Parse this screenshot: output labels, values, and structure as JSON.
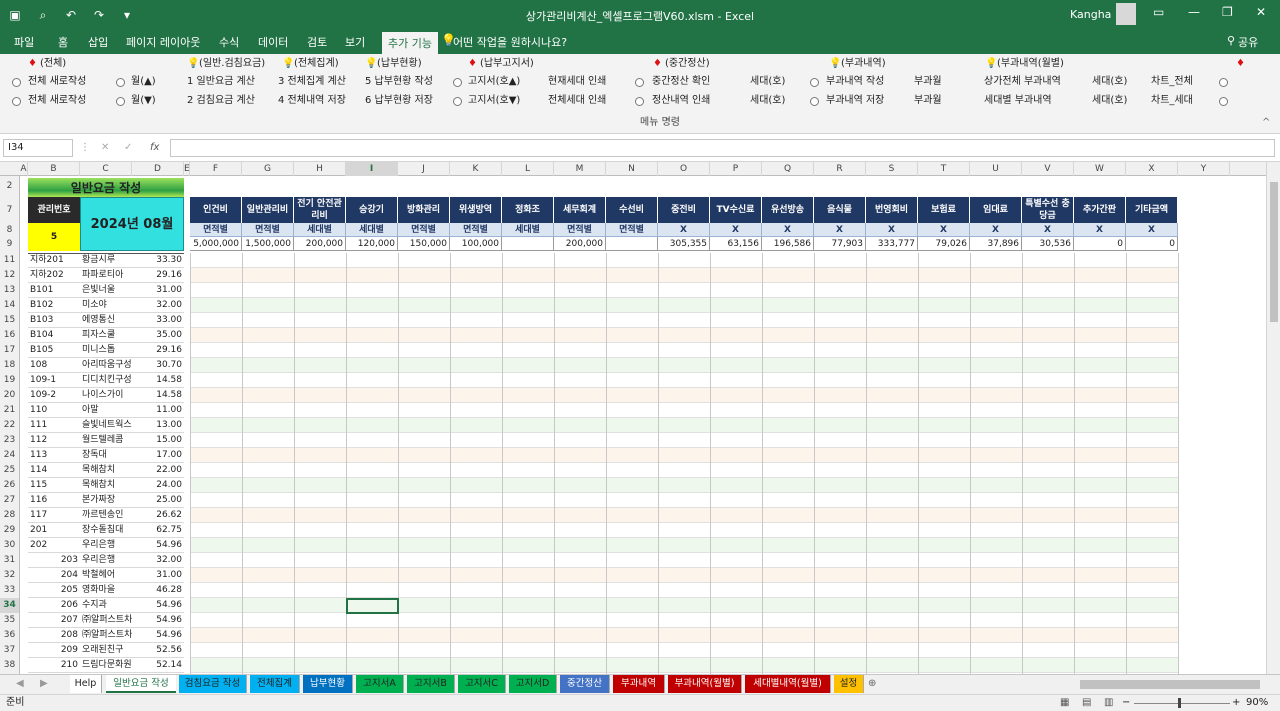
{
  "window": {
    "title": "상가관리비계산_엑셀프로그램V60.xlsm  -  Excel",
    "user": "Kangha"
  },
  "tabs": [
    "파일",
    "홈",
    "삽입",
    "페이지 레이아웃",
    "수식",
    "데이터",
    "검토",
    "보기",
    "추가 기능",
    "어떤 작업을 원하시나요?",
    "공유"
  ],
  "ribbon": {
    "group_label": "메뉴 명령",
    "headers": [
      "(전체)",
      "(일반.검침요금)",
      "(전체집계)",
      "(납부현황)",
      "(납부고지서)",
      "(중간정산)",
      "(부과내역)",
      "(부과내역(월별)"
    ],
    "row1": [
      "전체 새로작성",
      "월(▲)",
      "1  일반요금 계산",
      "3  전체집계 계산",
      "5  납부현황 작성",
      "고지서(호▲)",
      "현재세대 인쇄",
      "중간정산 확인",
      "세대(호)",
      "부과내역 작성",
      "부과월",
      "상가전체 부과내역",
      "세대(호)",
      "차트_전체"
    ],
    "row2": [
      "전체 새로작성",
      "월(▼)",
      "2  검침요금 계산",
      "4  전체내역 저장",
      "6  납부현황 저장",
      "고지서(호▼)",
      "전체세대 인쇄",
      "정산내역 인쇄",
      "세대(호)",
      "부과내역 저장",
      "부과월",
      "세대별 부과내역",
      "세대(호)",
      "차트_세대"
    ]
  },
  "formula_bar": {
    "name_box": "I34",
    "formula": ""
  },
  "columns": [
    "A",
    "B",
    "C",
    "D",
    "E",
    "F",
    "G",
    "H",
    "I",
    "J",
    "K",
    "L",
    "M",
    "N",
    "O",
    "P",
    "Q",
    "R",
    "S",
    "T",
    "U",
    "V",
    "W",
    "X",
    "Y"
  ],
  "sheet": {
    "title": "일반요금 작성",
    "mgmt_label": "관리번호",
    "mgmt_value": "5",
    "period": "2024년 08월",
    "fee_headers": [
      "인건비",
      "일반관리비",
      "전기 안전관리비",
      "승강기",
      "방화관리",
      "위생방역",
      "정화조",
      "세무회계",
      "수선비",
      "중전비",
      "TV수신료",
      "유선방송",
      "음식물",
      "번영회비",
      "보험료",
      "임대료",
      "특별수선 충당금",
      "추가간판",
      "기타금액"
    ],
    "fee_types": [
      "면적별",
      "면적별",
      "세대별",
      "세대별",
      "면적별",
      "면적별",
      "세대별",
      "면적별",
      "면적별",
      "X",
      "X",
      "X",
      "X",
      "X",
      "X",
      "X",
      "X",
      "X",
      "X"
    ],
    "fee_amounts": [
      "5,000,000",
      "1,500,000",
      "200,000",
      "120,000",
      "150,000",
      "100,000",
      "",
      "200,000",
      "",
      "305,355",
      "63,156",
      "196,586",
      "77,903",
      "333,777",
      "79,026",
      "37,896",
      "30,536",
      "0",
      "0"
    ],
    "units": [
      [
        "지하201",
        "황금시루",
        "33.30"
      ],
      [
        "지하202",
        "파파로티아",
        "29.16"
      ],
      [
        "B101",
        "은빛너울",
        "31.00"
      ],
      [
        "B102",
        "미소야",
        "32.00"
      ],
      [
        "B103",
        "에영통신",
        "33.00"
      ],
      [
        "B104",
        "피자스쿨",
        "35.00"
      ],
      [
        "B105",
        "미니스톱",
        "29.16"
      ],
      [
        "108",
        "아리따움구성",
        "30.70"
      ],
      [
        "109-1",
        "디디치킨구성",
        "14.58"
      ],
      [
        "109-2",
        "나이스가이",
        "14.58"
      ],
      [
        "110",
        "아말",
        "11.00"
      ],
      [
        "111",
        "슬빛네트웍스",
        "13.00"
      ],
      [
        "112",
        "월드텔레콤",
        "15.00"
      ],
      [
        "113",
        "장독대",
        "17.00"
      ],
      [
        "114",
        "목해참치",
        "22.00"
      ],
      [
        "115",
        "목해참치",
        "24.00"
      ],
      [
        "116",
        "본가짜장",
        "25.00"
      ],
      [
        "117",
        "까르텐송인",
        "26.62"
      ],
      [
        "201",
        "장수돌침대",
        "62.75"
      ],
      [
        "202",
        "우리은행",
        "54.96"
      ],
      [
        "203",
        "우리은행",
        "32.00"
      ],
      [
        "204",
        "박철헤어",
        "31.00"
      ],
      [
        "205",
        "영화마을",
        "46.28"
      ],
      [
        "206",
        "수지과",
        "54.96"
      ],
      [
        "207",
        "㈜알퍼스트차",
        "54.96"
      ],
      [
        "208",
        "㈜알퍼스트차",
        "54.96"
      ],
      [
        "209",
        "오래된친구",
        "52.56"
      ],
      [
        "210",
        "드림다문화원",
        "52.14"
      ]
    ]
  },
  "row_numbers": [
    "2",
    "7",
    "8",
    "9",
    "11",
    "12",
    "13",
    "14",
    "15",
    "16",
    "17",
    "18",
    "19",
    "20",
    "21",
    "22",
    "23",
    "24",
    "25",
    "26",
    "27",
    "28",
    "29",
    "30",
    "31",
    "32",
    "33",
    "34",
    "35",
    "36",
    "37",
    "38"
  ],
  "sheet_tabs": [
    "Help",
    "일반요금 작성",
    "검침요금 작성",
    "전체집계",
    "납부현황",
    "고지서A",
    "고지서B",
    "고지서C",
    "고지서D",
    "중간정산",
    "부과내역",
    "부과내역(월별)",
    "세대별내역(월별)",
    "설정"
  ],
  "status": {
    "ready": "준비",
    "zoom": "90%"
  },
  "colors": {
    "excel_green": "#217346",
    "header_navy": "#203864",
    "title_green": "#2ea043",
    "yellow": "#ffff00",
    "cyan": "#33e0e0"
  }
}
